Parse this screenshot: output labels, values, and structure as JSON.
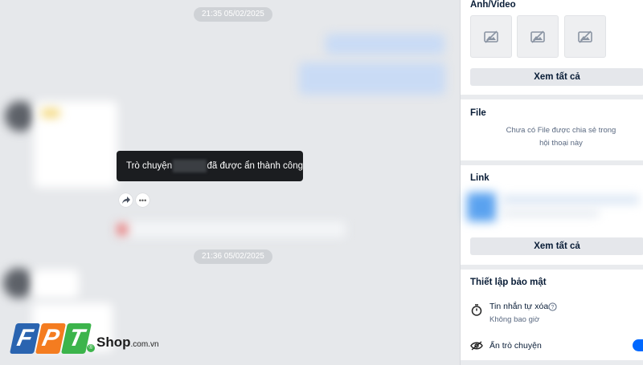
{
  "chat": {
    "timestamps": [
      "21:35 05/02/2025",
      "21:36 05/02/2025"
    ],
    "toast": {
      "prefix": "Trò chuyện",
      "suffix": "đã được ẩn thành công"
    },
    "share_icon": "share-arrow-icon",
    "more_icon": "ellipsis-icon"
  },
  "panel": {
    "media": {
      "title": "Ảnh/Video",
      "view_all": "Xem tất cả",
      "thumb_icon": "broken-image-icon"
    },
    "file": {
      "title": "File",
      "empty_line1": "Chưa có File được chia sẻ trong",
      "empty_line2": "hội thoại này"
    },
    "link": {
      "title": "Link",
      "view_all": "Xem tất cả"
    },
    "security": {
      "title": "Thiết lập bảo mật",
      "auto_delete_label": "Tin nhắn tự xóa",
      "auto_delete_value": "Không bao giờ",
      "hide_chat_label": "Ẩn trò chuyện",
      "hide_chat_enabled": true
    }
  },
  "logo": {
    "letters": [
      "F",
      "P",
      "T"
    ],
    "brand": "Shop",
    "domain": ".com.vn",
    "reg_mark": "®",
    "colors": {
      "blue": "#2a64b0",
      "orange": "#f47c20",
      "green": "#3cb44b"
    }
  }
}
